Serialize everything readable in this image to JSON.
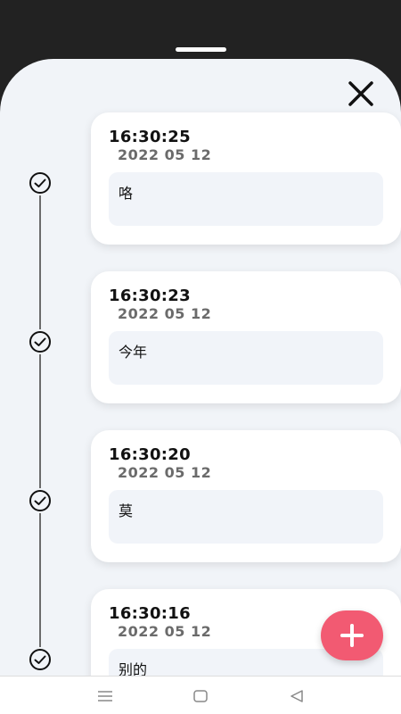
{
  "colors": {
    "background": "#222222",
    "sheet": "#f1f4f8",
    "card": "#ffffff",
    "accent": "#f25a72"
  },
  "entries": [
    {
      "time": "16:30:25",
      "date": "2022 05 12",
      "note": "咯"
    },
    {
      "time": "16:30:23",
      "date": "2022 05 12",
      "note": "今年"
    },
    {
      "time": "16:30:20",
      "date": "2022 05 12",
      "note": "莫"
    },
    {
      "time": "16:30:16",
      "date": "2022 05 12",
      "note": "别的"
    }
  ],
  "icons": {
    "close": "close-icon",
    "check": "check-circle-icon",
    "add": "plus-icon",
    "nav_menu": "menu-icon",
    "nav_home": "home-square-icon",
    "nav_back": "back-triangle-icon"
  }
}
